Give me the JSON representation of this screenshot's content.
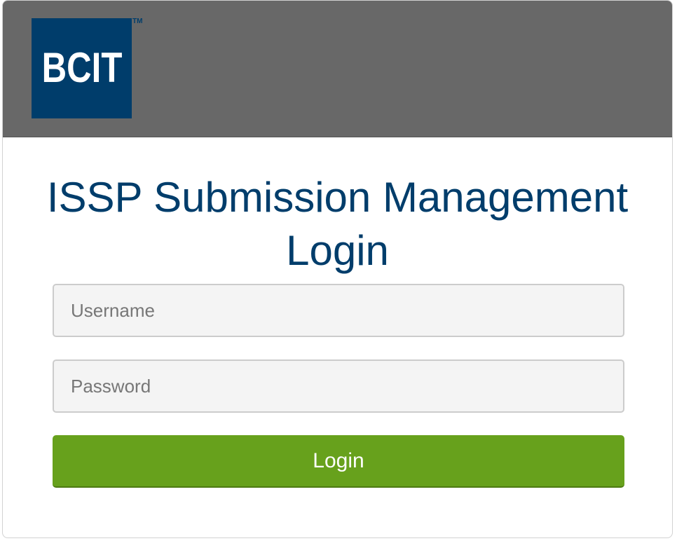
{
  "header": {
    "logo_text": "BCIT",
    "trademark": "TM",
    "background_color": "#686868",
    "logo_color": "#003d6b"
  },
  "main": {
    "title": "ISSP Submission Management Login",
    "title_color": "#003d6b"
  },
  "form": {
    "username_placeholder": "Username",
    "password_placeholder": "Password",
    "login_label": "Login",
    "button_color": "#67a11c"
  }
}
